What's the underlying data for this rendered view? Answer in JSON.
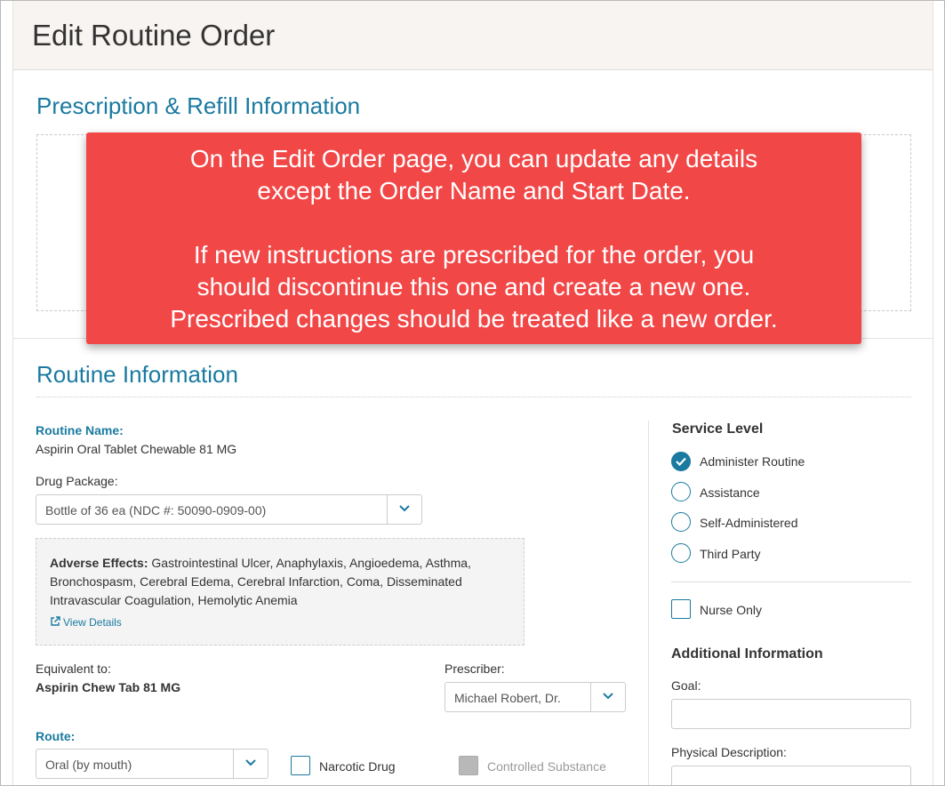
{
  "page": {
    "title": "Edit Routine Order"
  },
  "prescription": {
    "title": "Prescription & Refill Information"
  },
  "callout": {
    "line1": "On the Edit Order page, you can update any details",
    "line2": "except the Order Name and Start Date.",
    "line3": "If new instructions are prescribed for the order, you",
    "line4": "should discontinue this one and create a new one.",
    "line5": "Prescribed changes should be treated like a new order."
  },
  "routine": {
    "title": "Routine Information",
    "name_label": "Routine Name:",
    "name_value": "Aspirin Oral Tablet Chewable 81 MG",
    "package_label": "Drug Package:",
    "package_value": "Bottle of 36 ea (NDC #: 50090-0909-00)",
    "adverse_label": "Adverse Effects:",
    "adverse_text": "Gastrointestinal Ulcer, Anaphylaxis, Angioedema, Asthma,",
    "adverse_text2": "Bronchospasm, Cerebral Edema, Cerebral Infarction, Coma, Disseminated",
    "adverse_text3": "Intravascular Coagulation, Hemolytic Anemia",
    "view_details": "View Details",
    "equivalent_label": "Equivalent to:",
    "equivalent_value": "Aspirin Chew Tab 81 MG",
    "prescriber_label": "Prescriber:",
    "prescriber_value": "Michael Robert, Dr.",
    "route_label": "Route:",
    "route_value": "Oral (by mouth)",
    "narcotic_label": "Narcotic Drug",
    "controlled_label": "Controlled Substance"
  },
  "service_level": {
    "title": "Service Level",
    "options": [
      "Administer Routine",
      "Assistance",
      "Self-Administered",
      "Third Party"
    ],
    "selected": "Administer Routine",
    "nurse_only": "Nurse Only"
  },
  "additional": {
    "title": "Additional Information",
    "goal_label": "Goal:",
    "physical_label": "Physical Description:"
  },
  "colors": {
    "accent": "#1a7aa0",
    "callout": "#f24747",
    "header_bg": "#f8f4f2"
  },
  "icons": {
    "dropdown": "chevron-down-icon",
    "check": "checkmark-icon",
    "external": "external-link-icon"
  }
}
